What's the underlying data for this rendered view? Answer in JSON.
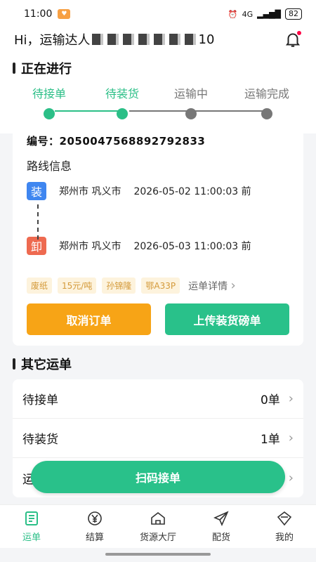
{
  "status_bar": {
    "time": "11:00",
    "battery": "82",
    "network": "4G"
  },
  "header": {
    "greeting_prefix": "Hi，运输达人",
    "greeting_suffix": "10"
  },
  "in_progress": {
    "title": "正在进行",
    "steps": [
      {
        "label": "待接单",
        "active": true
      },
      {
        "label": "待装货",
        "active": true
      },
      {
        "label": "运输中",
        "active": false
      },
      {
        "label": "运输完成",
        "active": false
      }
    ]
  },
  "order": {
    "number_label": "编号：",
    "number": "2050047568892792833",
    "route_title": "路线信息",
    "load": {
      "icon_text": "装",
      "place": "郑州市 巩义市",
      "time": "2026-05-02 11:00:03 前"
    },
    "unload": {
      "icon_text": "卸",
      "place": "郑州市 巩义市",
      "time": "2026-05-03 11:00:03 前"
    },
    "tags": [
      "废纸",
      "15元/吨",
      "孙锦隆",
      "鄂A33P"
    ],
    "detail_label": "运单详情",
    "cancel_label": "取消订单",
    "upload_label": "上传装货磅单"
  },
  "other": {
    "title": "其它运单",
    "rows": [
      {
        "label": "待接单",
        "count": "0单"
      },
      {
        "label": "待装货",
        "count": "1单"
      },
      {
        "label": "运",
        "count": ""
      }
    ]
  },
  "scan_button": "扫码接单",
  "tabs": [
    {
      "label": "运单",
      "icon": "waybill-icon",
      "active": true
    },
    {
      "label": "结算",
      "icon": "yen-icon",
      "active": false
    },
    {
      "label": "货源大厅",
      "icon": "home-icon",
      "active": false
    },
    {
      "label": "配货",
      "icon": "send-icon",
      "active": false
    },
    {
      "label": "我的",
      "icon": "profile-icon",
      "active": false
    }
  ],
  "colors": {
    "accent": "#2bbf87",
    "orange": "#f7a416",
    "load_blue": "#3f86f0",
    "unload_red": "#ee6a50"
  }
}
